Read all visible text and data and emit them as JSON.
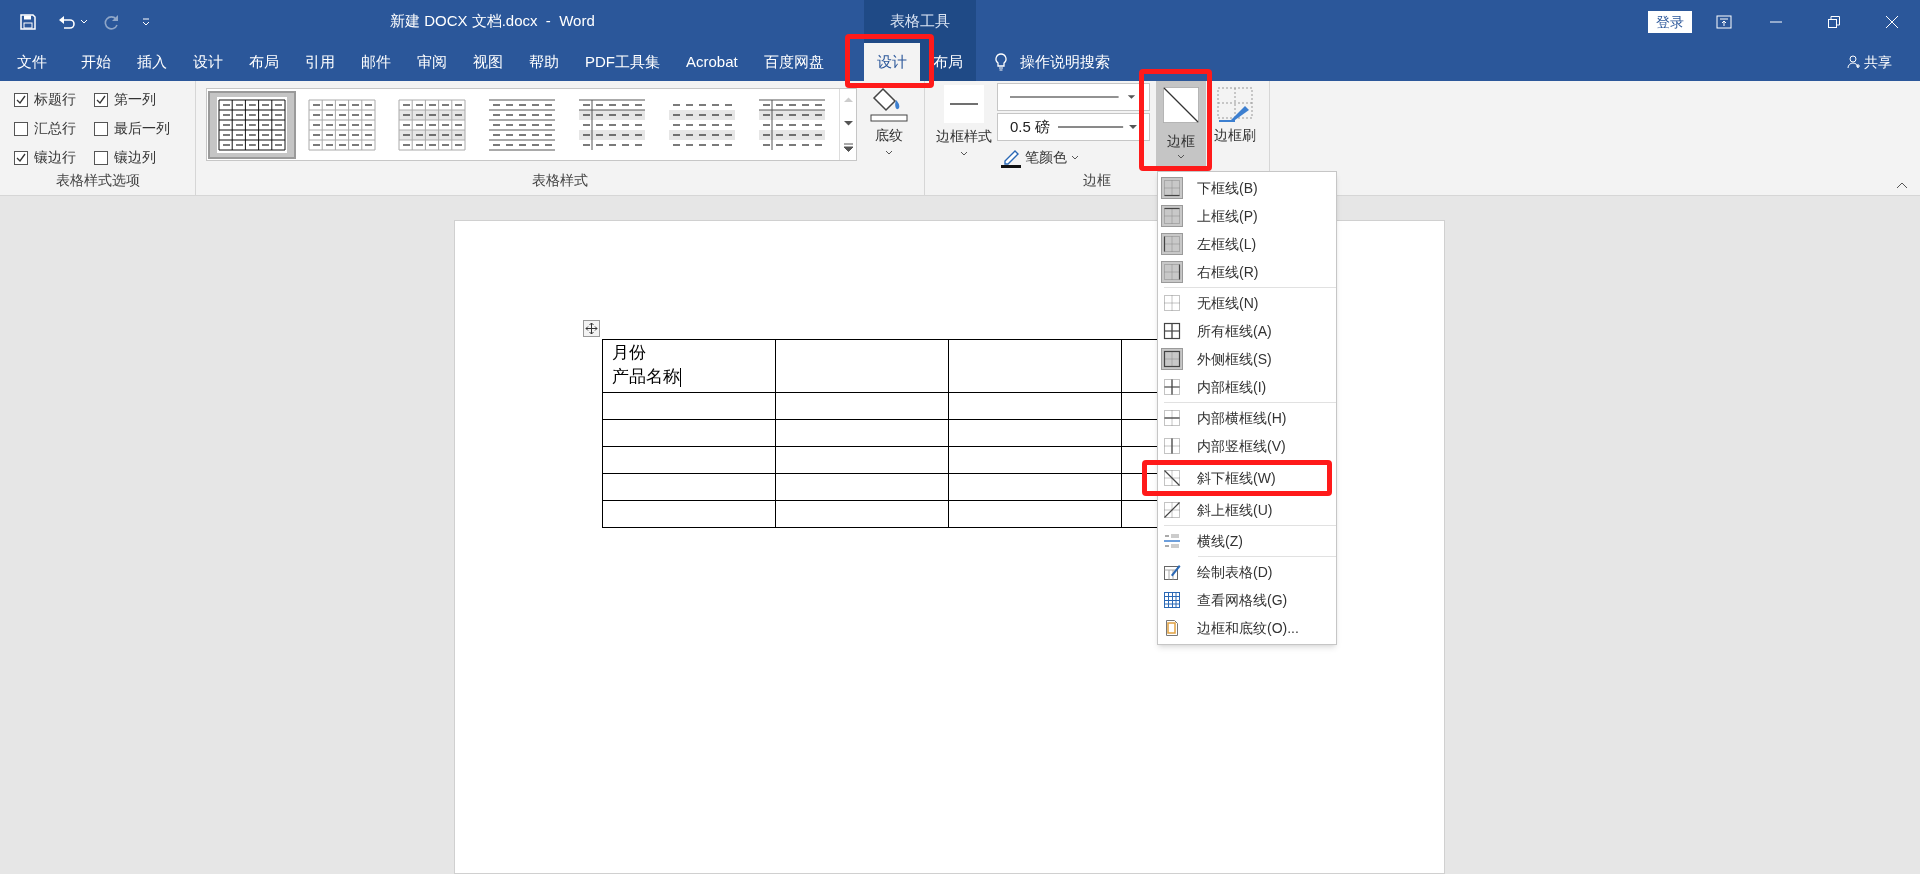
{
  "title_bar": {
    "title": "新建 DOCX 文档.docx  -  Word",
    "context_label": "表格工具",
    "sign_in": "登录"
  },
  "tabs": [
    {
      "label": "文件",
      "selected": false
    },
    {
      "label": "开始",
      "selected": false
    },
    {
      "label": "插入",
      "selected": false
    },
    {
      "label": "设计",
      "selected": false
    },
    {
      "label": "布局",
      "selected": false
    },
    {
      "label": "引用",
      "selected": false
    },
    {
      "label": "邮件",
      "selected": false
    },
    {
      "label": "审阅",
      "selected": false
    },
    {
      "label": "视图",
      "selected": false
    },
    {
      "label": "帮助",
      "selected": false
    },
    {
      "label": "PDF工具集",
      "selected": false
    },
    {
      "label": "Acrobat",
      "selected": false
    },
    {
      "label": "百度网盘",
      "selected": false
    }
  ],
  "context_tabs": [
    {
      "label": "设计",
      "selected": true
    },
    {
      "label": "布局",
      "selected": false
    }
  ],
  "tell_me": "操作说明搜索",
  "share": "共享",
  "style_options": {
    "label": "表格样式选项",
    "options": [
      {
        "label": "标题行",
        "checked": true
      },
      {
        "label": "第一列",
        "checked": true
      },
      {
        "label": "汇总行",
        "checked": false
      },
      {
        "label": "最后一列",
        "checked": false
      },
      {
        "label": "镶边行",
        "checked": true
      },
      {
        "label": "镶边列",
        "checked": false
      }
    ]
  },
  "table_styles": {
    "label": "表格样式",
    "styles": [
      {
        "kind": "grid",
        "selected": true
      },
      {
        "kind": "light",
        "selected": false
      },
      {
        "kind": "shaded",
        "selected": false
      },
      {
        "kind": "rules",
        "selected": false
      },
      {
        "kind": "column",
        "selected": false
      },
      {
        "kind": "banded",
        "selected": false
      },
      {
        "kind": "column",
        "selected": false
      }
    ],
    "shading": "底纹"
  },
  "borders": {
    "label": "边框",
    "border_styles": "边框样式",
    "line_weight": "0.5 磅",
    "pen_color": "笔颜色",
    "border_button": {
      "label": "边框",
      "pressed": true
    },
    "border_painter": "边框刷"
  },
  "menu": {
    "sections": [
      [
        {
          "label": "下框线(B)",
          "kind": "bottom",
          "on": true
        },
        {
          "label": "上框线(P)",
          "kind": "top",
          "on": true
        },
        {
          "label": "左框线(L)",
          "kind": "left",
          "on": true
        },
        {
          "label": "右框线(R)",
          "kind": "right",
          "on": true
        }
      ],
      [
        {
          "label": "无框线(N)",
          "kind": "none",
          "on": false
        },
        {
          "label": "所有框线(A)",
          "kind": "all",
          "on": false
        },
        {
          "label": "外侧框线(S)",
          "kind": "outside",
          "on": true
        },
        {
          "label": "内部框线(I)",
          "kind": "inside",
          "on": false
        }
      ],
      [
        {
          "label": "内部横框线(H)",
          "kind": "insideh",
          "on": false
        },
        {
          "label": "内部竖框线(V)",
          "kind": "insidev",
          "on": false
        },
        {
          "label": "斜下框线(W)",
          "kind": "diagdown",
          "on": false,
          "highlighted": true
        },
        {
          "label": "斜上框线(U)",
          "kind": "diagup",
          "on": false
        }
      ],
      [
        {
          "label": "横线(Z)",
          "kind": "hline",
          "on": false
        }
      ],
      [
        {
          "label": "绘制表格(D)",
          "kind": "draw",
          "on": false
        },
        {
          "label": "查看网格线(G)",
          "kind": "gridlines",
          "on": false
        },
        {
          "label": "边框和底纹(O)...",
          "kind": "dialog",
          "on": false
        }
      ]
    ]
  },
  "document": {
    "table": {
      "rows": [
        [
          {
            "lines": [
              "月份",
              "产品名称"
            ],
            "cursor": true
          },
          {},
          {},
          {}
        ],
        [
          {},
          {},
          {},
          {}
        ],
        [
          {},
          {},
          {},
          {}
        ],
        [
          {},
          {},
          {},
          {}
        ],
        [
          {},
          {},
          {},
          {}
        ],
        [
          {},
          {},
          {},
          {}
        ]
      ]
    }
  }
}
